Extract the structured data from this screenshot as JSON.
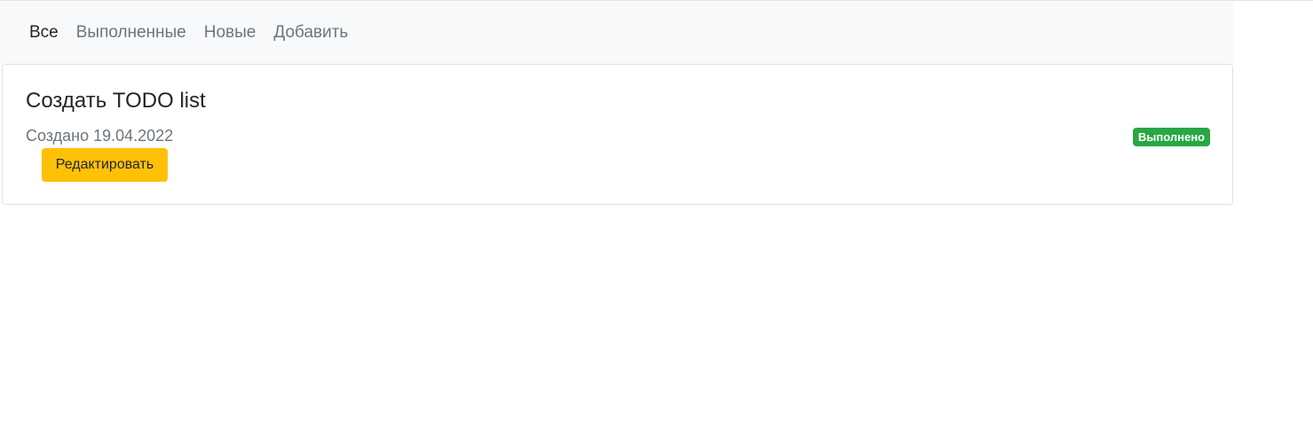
{
  "nav": {
    "items": [
      {
        "label": "Все",
        "active": true
      },
      {
        "label": "Выполненные",
        "active": false
      },
      {
        "label": "Новые",
        "active": false
      },
      {
        "label": "Добавить",
        "active": false
      }
    ]
  },
  "task": {
    "title": "Создать TODO list",
    "created": "Создано 19.04.2022",
    "edit_label": "Редактировать",
    "status": "Выполнено"
  },
  "colors": {
    "navbar_bg": "#f8f9fa",
    "edit_button": "#ffc107",
    "status_badge": "#28a745"
  }
}
